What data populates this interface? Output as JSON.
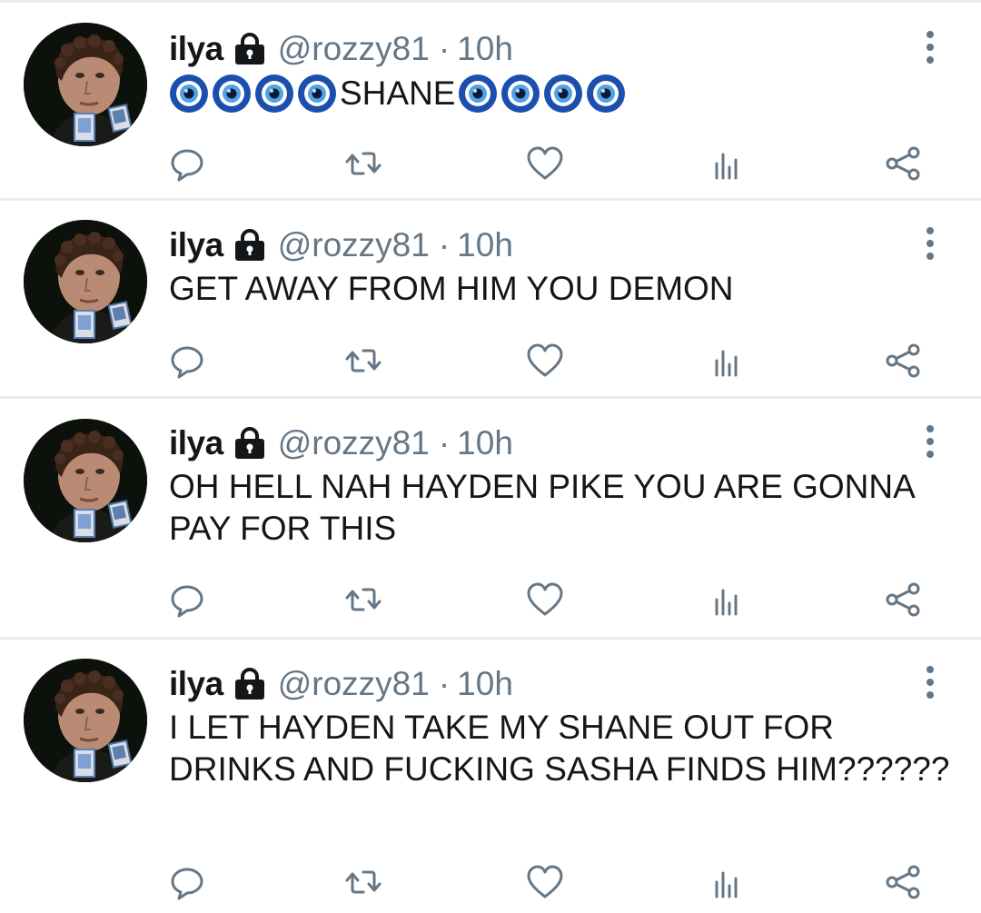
{
  "colors": {
    "text": "#14171a",
    "secondary": "#657786",
    "divider": "#e6ecf0",
    "nazar_blue": "#1b4fae"
  },
  "tweets": [
    {
      "display_name": "ilya",
      "handle": "@rozzy81",
      "separator": "·",
      "time": "10h",
      "lock_icon": "lock-icon",
      "text_prefix_icons": 4,
      "text": "SHANE",
      "text_suffix_icons": 4,
      "icon_name": "nazar-amulet-icon"
    },
    {
      "display_name": "ilya",
      "handle": "@rozzy81",
      "separator": "·",
      "time": "10h",
      "lock_icon": "lock-icon",
      "text": "GET AWAY FROM HIM YOU DEMON"
    },
    {
      "display_name": "ilya",
      "handle": "@rozzy81",
      "separator": "·",
      "time": "10h",
      "lock_icon": "lock-icon",
      "text": "OH HELL NAH HAYDEN PIKE YOU ARE GONNA PAY FOR THIS"
    },
    {
      "display_name": "ilya",
      "handle": "@rozzy81",
      "separator": "·",
      "time": "10h",
      "lock_icon": "lock-icon",
      "text": "I LET HAYDEN TAKE MY SHANE OUT FOR DRINKS AND FUCKING SASHA FINDS HIM??????"
    }
  ],
  "action_icons": [
    "reply-icon",
    "retweet-icon",
    "like-icon",
    "analytics-icon",
    "share-icon"
  ]
}
